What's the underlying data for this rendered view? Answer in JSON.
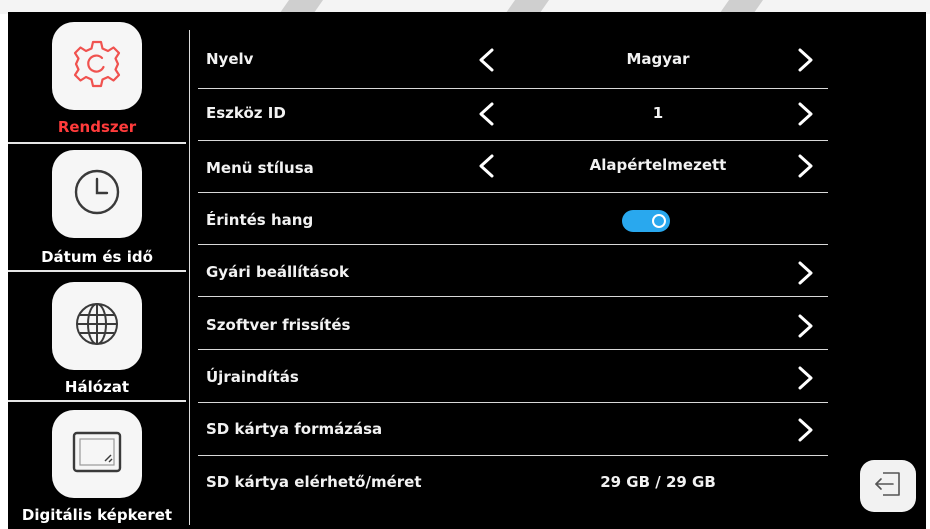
{
  "sidebar": {
    "items": [
      {
        "label": "Rendszer",
        "icon": "gear-icon",
        "active": true
      },
      {
        "label": "Dátum és idő",
        "icon": "clock-icon",
        "active": false
      },
      {
        "label": "Hálózat",
        "icon": "globe-icon",
        "active": false
      },
      {
        "label": "Digitális képkeret",
        "icon": "picture-frame-icon",
        "active": false
      }
    ]
  },
  "settings": {
    "language": {
      "label": "Nyelv",
      "value": "Magyar"
    },
    "device_id": {
      "label": "Eszköz ID",
      "value": "1"
    },
    "menu_style": {
      "label": "Menü stílusa",
      "value": "Alapértelmezett"
    },
    "touch_sound": {
      "label": "Érintés hang",
      "enabled": true
    },
    "factory_settings": {
      "label": "Gyári beállítások"
    },
    "software_update": {
      "label": "Szoftver frissítés"
    },
    "restart": {
      "label": "Újraindítás"
    },
    "sd_format": {
      "label": "SD kártya formázása"
    },
    "sd_capacity": {
      "label": "SD kártya elérhető/méret",
      "value": "29 GB / 29 GB"
    }
  },
  "colors": {
    "background": "#000000",
    "active_label": "#ff3b3b",
    "toggle_on": "#29a8ee",
    "text": "#f2f2f2"
  },
  "icons": {
    "arrow_left": "chevron-left-icon",
    "arrow_right": "chevron-right-icon",
    "back": "back-arrow-icon"
  }
}
